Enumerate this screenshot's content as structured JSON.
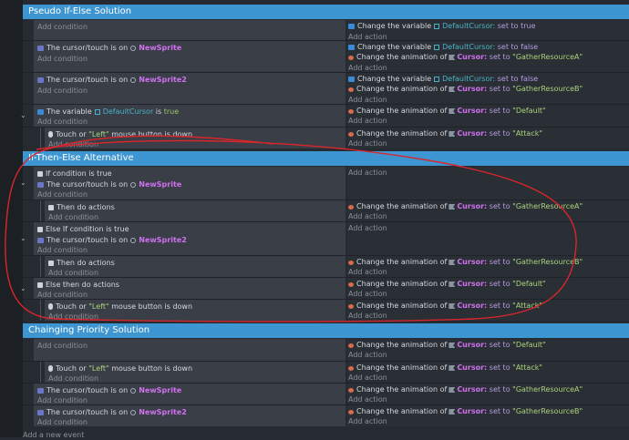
{
  "groups": [
    {
      "title": "Pseudo If-Else Solution"
    },
    {
      "title": "If-Then-Else Alternative"
    },
    {
      "title": "Chainging Priority Solution"
    }
  ],
  "common": {
    "add_condition": "Add condition",
    "add_action": "Add action",
    "add_event": "Add a new event",
    "cursor_is_on": "The cursor/touch is on",
    "change_variable": "Change the variable",
    "change_animation": "Change the animation of",
    "set_to": "set to",
    "touch_or": "Touch or",
    "mouse_button_down": "mouse button is down",
    "the_variable": "The variable",
    "is": "is",
    "if_condition_true": "If condition is true",
    "else_if_condition_true": "Else If condition is true",
    "then_do_actions": "Then do actions",
    "else_then_do_actions": "Else then do actions"
  },
  "names": {
    "default_cursor": "DefaultCursor:",
    "default_cursor_plain": "DefaultCursor",
    "cursor": "Cursor:",
    "newsprite": "NewSprite",
    "newsprite2": "NewSprite2",
    "true": "true",
    "false": "false",
    "left": "\"Left\"",
    "default": "\"Default\"",
    "attack": "\"Attack\"",
    "gather_a": "\"GatherResourceA\"",
    "gather_b": "\"GatherResourceB\""
  },
  "colors": {
    "group_header": "#3d95d1",
    "object": "#cf71ef",
    "variable": "#4ab3c9",
    "string": "#aad37c",
    "annotation": "#d9262c"
  }
}
